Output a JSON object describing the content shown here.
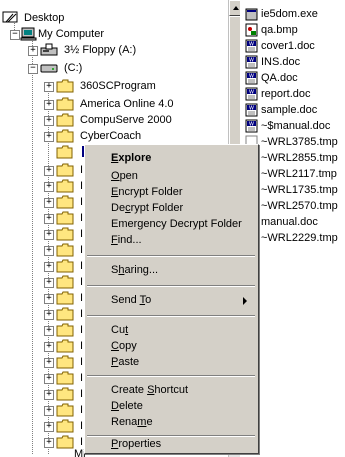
{
  "tree": {
    "items": [
      {
        "label": "Desktop",
        "icon": "desktop-icon"
      },
      {
        "label": "My Computer",
        "icon": "computer-icon"
      },
      {
        "label": "3½ Floppy (A:)",
        "icon": "floppy-drive-icon"
      },
      {
        "label": "(C:)",
        "icon": "hard-drive-icon"
      },
      {
        "label": "360SCProgram",
        "icon": "folder-icon"
      },
      {
        "label": "America Online 4.0",
        "icon": "folder-icon"
      },
      {
        "label": "CompuServe 2000",
        "icon": "folder-icon"
      },
      {
        "label": "CyberCoach",
        "icon": "folder-icon"
      },
      {
        "label": "",
        "icon": "folder-icon",
        "selected": true
      }
    ],
    "clipped_labels": [
      "I",
      "I",
      "I",
      "I",
      "I",
      "I",
      "I",
      "I",
      "I",
      "I",
      "I",
      "I",
      "I",
      "I",
      "I",
      "I",
      "I",
      "I"
    ],
    "bottom_label": "Mi"
  },
  "files": [
    {
      "name": "ie5dom.exe",
      "icon": "exe-icon"
    },
    {
      "name": "qa.bmp",
      "icon": "bmp-icon"
    },
    {
      "name": "cover1.doc",
      "icon": "doc-icon"
    },
    {
      "name": "INS.doc",
      "icon": "doc-icon"
    },
    {
      "name": "QA.doc",
      "icon": "doc-icon"
    },
    {
      "name": "report.doc",
      "icon": "doc-icon"
    },
    {
      "name": "sample.doc",
      "icon": "doc-icon"
    },
    {
      "name": "~$manual.doc",
      "icon": "doc-icon"
    },
    {
      "name": "~WRL3785.tmp",
      "icon": "tmp-icon"
    },
    {
      "name": "~WRL2855.tmp",
      "icon": "tmp-icon"
    },
    {
      "name": "~WRL2117.tmp",
      "icon": "tmp-icon"
    },
    {
      "name": "~WRL1735.tmp",
      "icon": "tmp-icon"
    },
    {
      "name": "~WRL2570.tmp",
      "icon": "tmp-icon"
    },
    {
      "name": "manual.doc",
      "icon": "doc-icon"
    },
    {
      "name": "~WRL2229.tmp",
      "icon": "tmp-icon"
    }
  ],
  "context_menu": {
    "explore": {
      "pre": "",
      "key": "E",
      "post": "xplore"
    },
    "open": {
      "pre": "",
      "key": "O",
      "post": "pen"
    },
    "encrypt": {
      "pre": "",
      "key": "E",
      "post": "ncrypt Folder"
    },
    "decrypt": {
      "pre": "De",
      "key": "c",
      "post": "rypt Folder"
    },
    "emergency": {
      "pre": "Emergency Decrypt Folder",
      "key": "",
      "post": ""
    },
    "find": {
      "pre": "",
      "key": "F",
      "post": "ind..."
    },
    "sharing": {
      "pre": "S",
      "key": "h",
      "post": "aring..."
    },
    "send_to": {
      "pre": "Send ",
      "key": "T",
      "post": "o"
    },
    "cut": {
      "pre": "Cu",
      "key": "t",
      "post": ""
    },
    "copy": {
      "pre": "",
      "key": "C",
      "post": "opy"
    },
    "paste": {
      "pre": "",
      "key": "P",
      "post": "aste"
    },
    "create_shortcut": {
      "pre": "Create ",
      "key": "S",
      "post": "hortcut"
    },
    "delete": {
      "pre": "",
      "key": "D",
      "post": "elete"
    },
    "rename": {
      "pre": "Rena",
      "key": "m",
      "post": "e"
    },
    "properties": {
      "pre": "",
      "key": "P",
      "post": "roperties"
    }
  }
}
